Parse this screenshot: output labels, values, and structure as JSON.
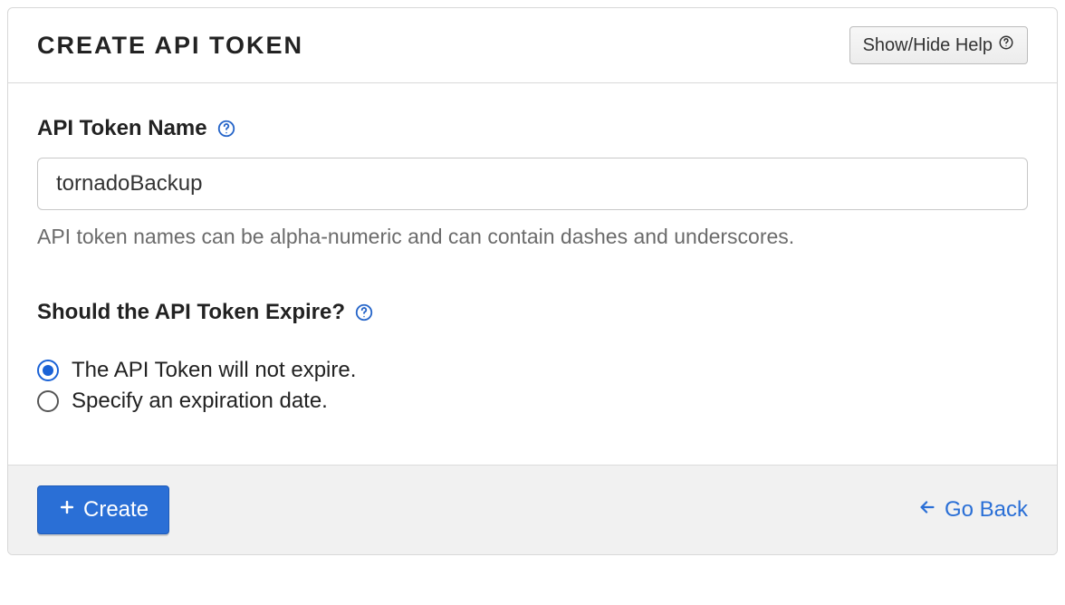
{
  "header": {
    "title": "CREATE API TOKEN",
    "help_button": "Show/Hide Help"
  },
  "token_name": {
    "label": "API Token Name",
    "value": "tornadoBackup",
    "hint": "API token names can be alpha-numeric and can contain dashes and underscores."
  },
  "expire": {
    "label": "Should the API Token Expire?",
    "options": [
      {
        "label": "The API Token will not expire.",
        "selected": true
      },
      {
        "label": "Specify an expiration date.",
        "selected": false
      }
    ]
  },
  "footer": {
    "create_label": "Create",
    "go_back_label": "Go Back"
  }
}
